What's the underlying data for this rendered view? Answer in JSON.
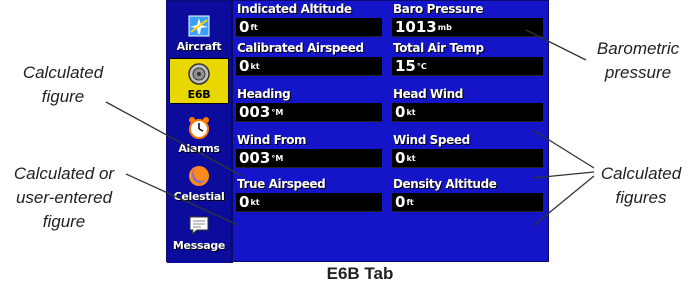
{
  "sidebar": {
    "tabs": [
      {
        "label": "Aircraft",
        "icon": "aircraft-icon",
        "active": false
      },
      {
        "label": "E6B",
        "icon": "e6b-icon",
        "active": true
      },
      {
        "label": "Alarms",
        "icon": "alarm-clock-icon",
        "active": false
      },
      {
        "label": "Celestial",
        "icon": "celestial-icon",
        "active": false
      },
      {
        "label": "Message",
        "icon": "message-icon",
        "active": false
      }
    ]
  },
  "fields": {
    "indicated_altitude": {
      "label": "Indicated Altitude",
      "value": "0",
      "unit": "ft"
    },
    "baro_pressure": {
      "label": "Baro Pressure",
      "value": "1013",
      "unit": "mb"
    },
    "calibrated_airspeed": {
      "label": "Calibrated Airspeed",
      "value": "0",
      "unit": "kt"
    },
    "total_air_temp": {
      "label": "Total Air Temp",
      "value": "15",
      "unit": "°C"
    },
    "heading": {
      "label": "Heading",
      "value": "003",
      "unit": "°M"
    },
    "head_wind": {
      "label": "Head Wind",
      "value": "0",
      "unit": "kt"
    },
    "wind_from": {
      "label": "Wind From",
      "value": "003",
      "unit": "°M"
    },
    "wind_speed": {
      "label": "Wind Speed",
      "value": "0",
      "unit": "kt"
    },
    "true_airspeed": {
      "label": "True Airspeed",
      "value": "0",
      "unit": "kt"
    },
    "density_altitude": {
      "label": "Density Altitude",
      "value": "0",
      "unit": "ft"
    }
  },
  "callouts": {
    "calculated_figure_1": "Calculated",
    "calculated_figure_2": "figure",
    "calc_or_user_1": "Calculated or",
    "calc_or_user_2": "user-entered",
    "calc_or_user_3": "figure",
    "barometric_1": "Barometric",
    "barometric_2": "pressure",
    "calculated_figures_1": "Calculated",
    "calculated_figures_2": "figures"
  },
  "caption": "E6B Tab",
  "colors": {
    "screen_bg": "#1414c8",
    "sidebar_bg": "#0c0c9c",
    "active_tab": "#e8d800",
    "field_bg": "#000000"
  }
}
